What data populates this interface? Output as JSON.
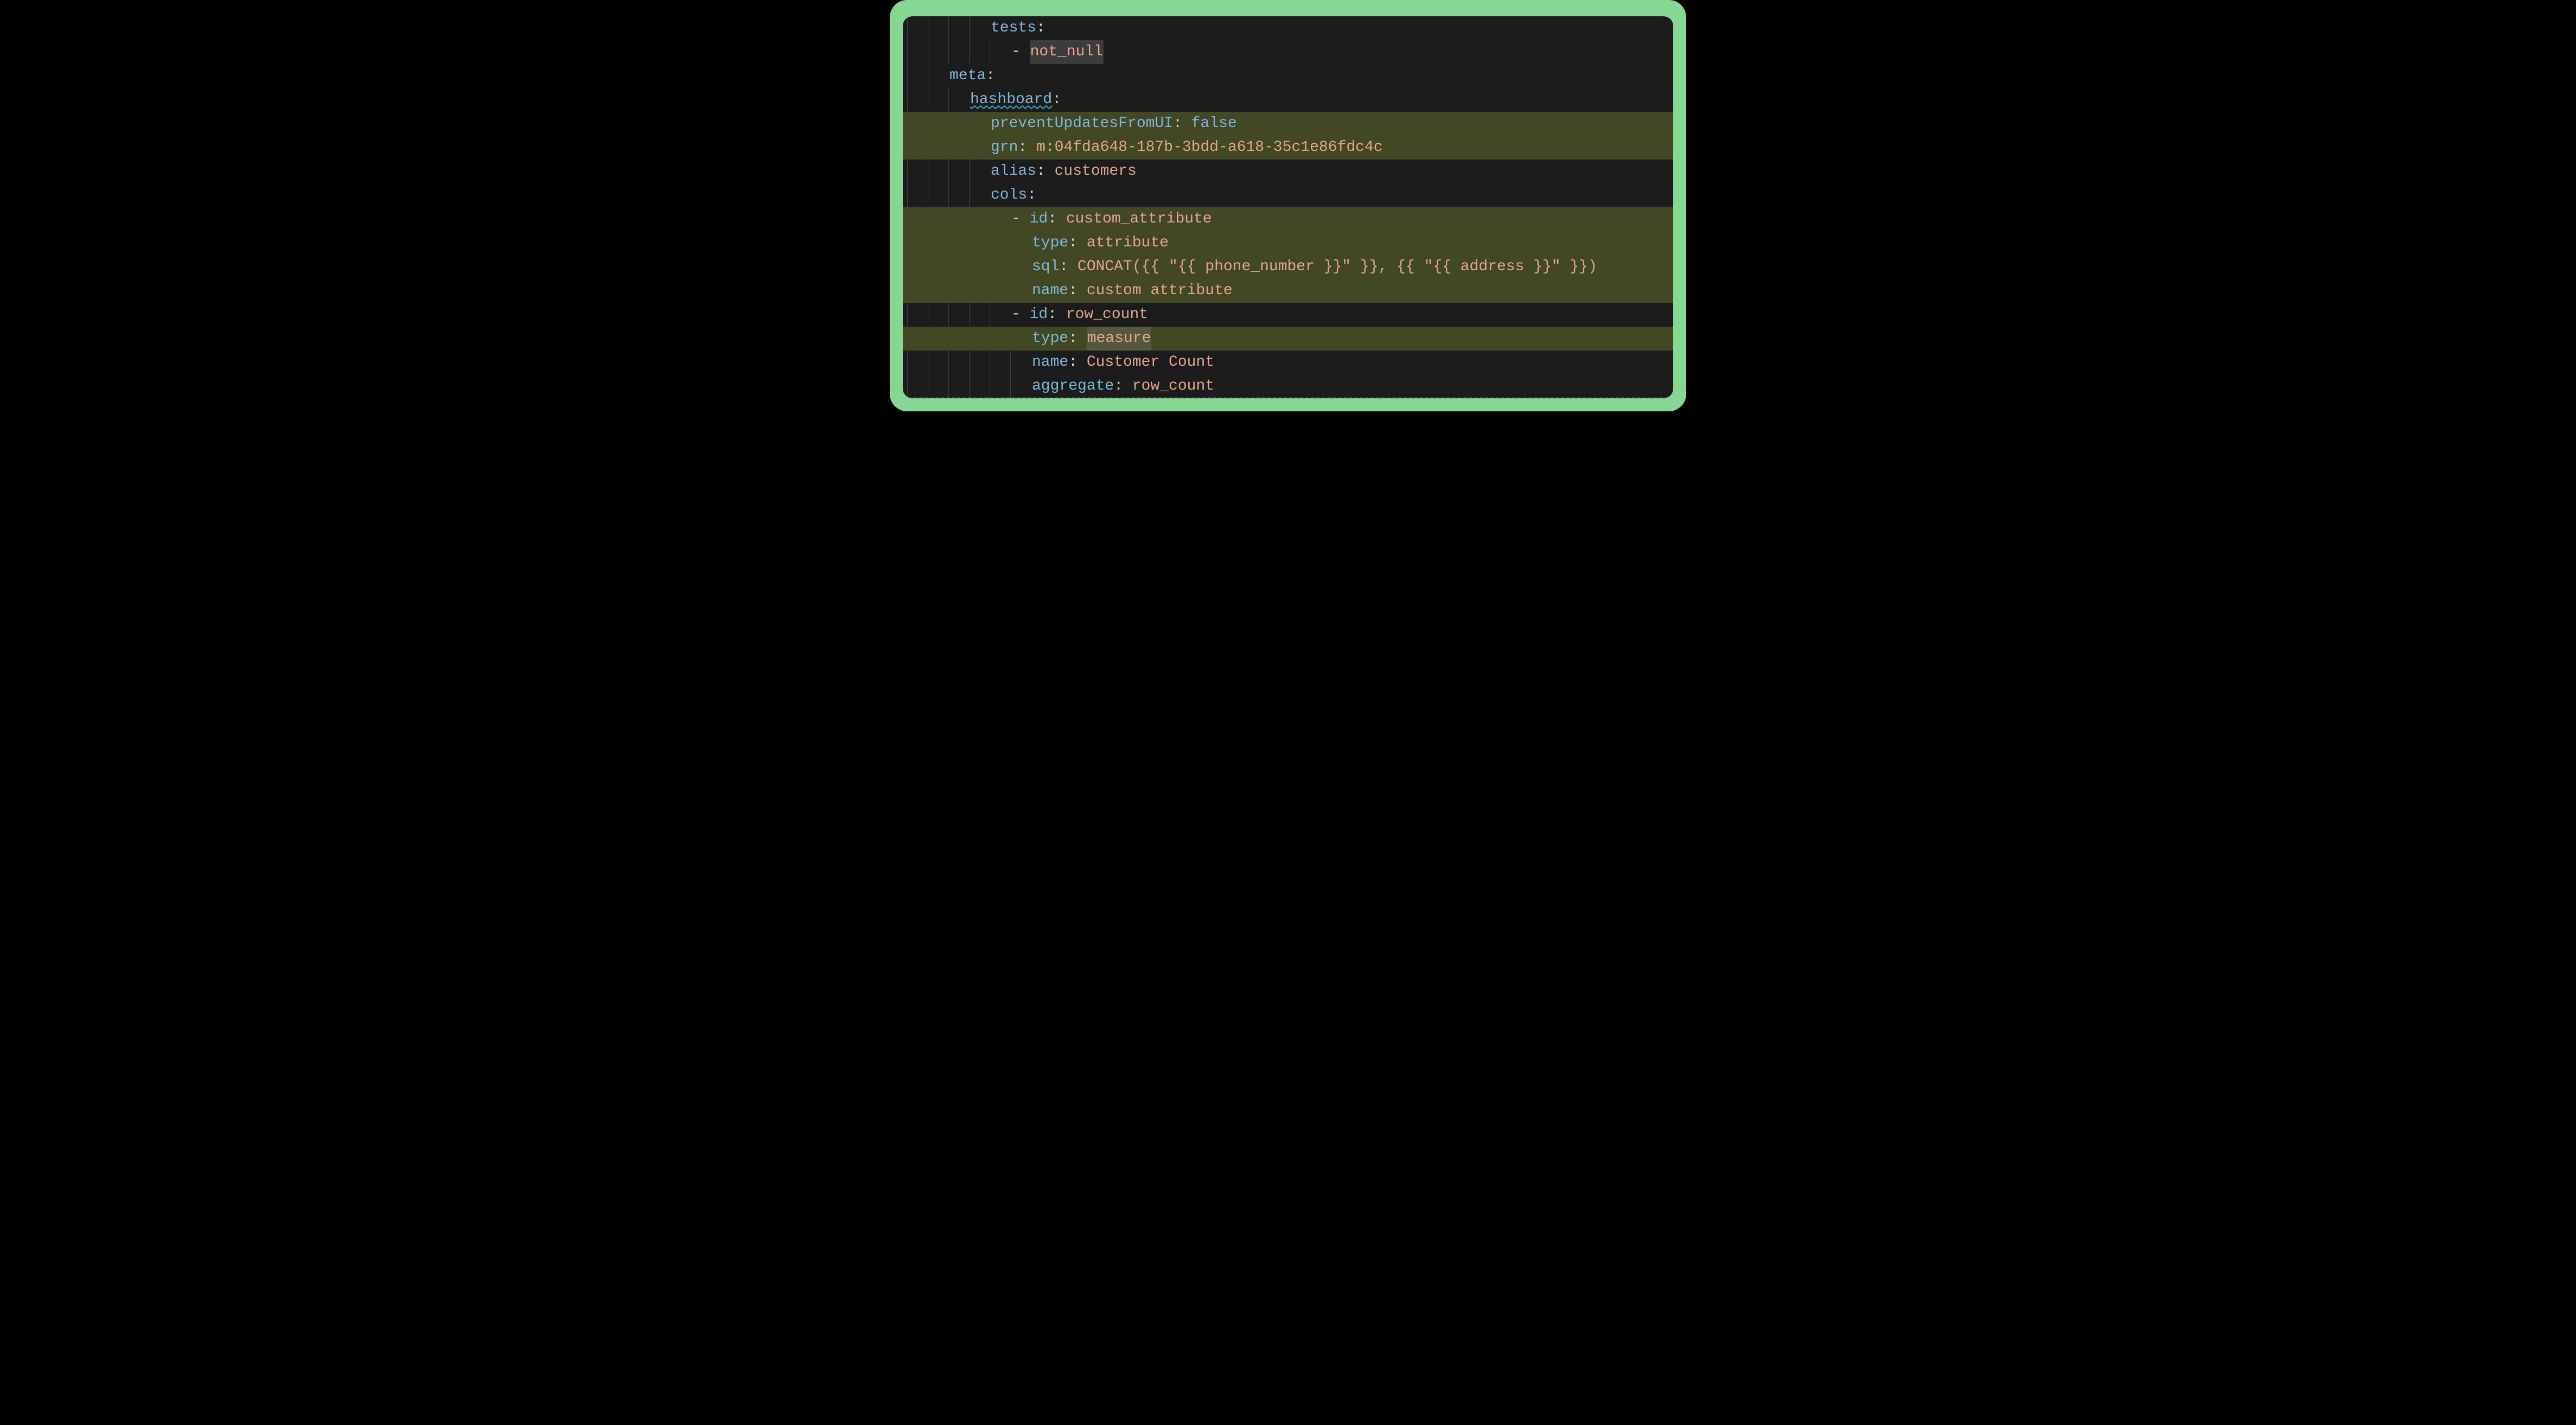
{
  "code": {
    "lines": [
      {
        "indent": 4,
        "hl": false,
        "tokens": [
          {
            "t": "key",
            "v": "tests"
          },
          {
            "t": "punct",
            "v": ":"
          }
        ]
      },
      {
        "indent": 5,
        "hl": false,
        "tokens": [
          {
            "t": "dash",
            "v": "- "
          },
          {
            "t": "sel",
            "v": "not_null"
          }
        ]
      },
      {
        "indent": 2,
        "hl": false,
        "tokens": [
          {
            "t": "key",
            "v": "meta"
          },
          {
            "t": "punct",
            "v": ":"
          }
        ]
      },
      {
        "indent": 3,
        "hl": false,
        "tokens": [
          {
            "t": "key_squiggle",
            "v": "hashboard"
          },
          {
            "t": "punct",
            "v": ":"
          }
        ]
      },
      {
        "indent": 4,
        "hl": true,
        "tokens": [
          {
            "t": "key",
            "v": "preventUpdatesFromUI"
          },
          {
            "t": "punct",
            "v": ": "
          },
          {
            "t": "key",
            "v": "false"
          }
        ]
      },
      {
        "indent": 4,
        "hl": true,
        "tokens": [
          {
            "t": "key",
            "v": "grn"
          },
          {
            "t": "punct",
            "v": ": "
          },
          {
            "t": "val",
            "v": "m:04fda648-187b-3bdd-a618-35c1e86fdc4c"
          }
        ]
      },
      {
        "indent": 4,
        "hl": false,
        "tokens": [
          {
            "t": "key",
            "v": "alias"
          },
          {
            "t": "punct",
            "v": ": "
          },
          {
            "t": "val",
            "v": "customers"
          }
        ]
      },
      {
        "indent": 4,
        "hl": false,
        "tokens": [
          {
            "t": "key",
            "v": "cols"
          },
          {
            "t": "punct",
            "v": ":"
          }
        ]
      },
      {
        "indent": 5,
        "hl": true,
        "tokens": [
          {
            "t": "dash",
            "v": "- "
          },
          {
            "t": "key",
            "v": "id"
          },
          {
            "t": "punct",
            "v": ": "
          },
          {
            "t": "val",
            "v": "custom_attribute"
          }
        ]
      },
      {
        "indent": 6,
        "hl": true,
        "tokens": [
          {
            "t": "key",
            "v": "type"
          },
          {
            "t": "punct",
            "v": ": "
          },
          {
            "t": "val",
            "v": "attribute"
          }
        ]
      },
      {
        "indent": 6,
        "hl": true,
        "tokens": [
          {
            "t": "key",
            "v": "sql"
          },
          {
            "t": "punct",
            "v": ": "
          },
          {
            "t": "val",
            "v": "CONCAT({{ \"{{ phone_number }}\" }}, {{ \"{{ address }}\" }})"
          }
        ]
      },
      {
        "indent": 6,
        "hl": true,
        "tokens": [
          {
            "t": "key",
            "v": "name"
          },
          {
            "t": "punct",
            "v": ": "
          },
          {
            "t": "val",
            "v": "custom attribute"
          }
        ]
      },
      {
        "indent": 5,
        "hl": false,
        "tokens": [
          {
            "t": "dash",
            "v": "- "
          },
          {
            "t": "key",
            "v": "id"
          },
          {
            "t": "punct",
            "v": ": "
          },
          {
            "t": "val",
            "v": "row_count"
          }
        ]
      },
      {
        "indent": 6,
        "hl": true,
        "tokens": [
          {
            "t": "key",
            "v": "type"
          },
          {
            "t": "punct",
            "v": ": "
          },
          {
            "t": "sel",
            "v": "measure"
          }
        ]
      },
      {
        "indent": 6,
        "hl": false,
        "tokens": [
          {
            "t": "key",
            "v": "name"
          },
          {
            "t": "punct",
            "v": ": "
          },
          {
            "t": "val",
            "v": "Customer Count"
          }
        ]
      },
      {
        "indent": 6,
        "hl": false,
        "tokens": [
          {
            "t": "key",
            "v": "aggregate"
          },
          {
            "t": "punct",
            "v": ": "
          },
          {
            "t": "val",
            "v": "row_count"
          }
        ]
      }
    ]
  }
}
